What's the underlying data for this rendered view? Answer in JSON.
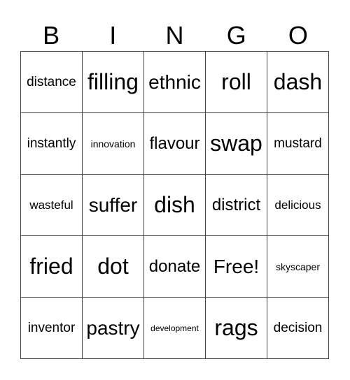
{
  "header": {
    "letters": [
      "B",
      "I",
      "N",
      "G",
      "O"
    ]
  },
  "cells": [
    [
      "distance",
      "filling",
      "ethnic",
      "roll",
      "dash"
    ],
    [
      "instantly",
      "innovation",
      "flavour",
      "swap",
      "mustard"
    ],
    [
      "wasteful",
      "suffer",
      "dish",
      "district",
      "delicious"
    ],
    [
      "fried",
      "dot",
      "donate",
      "Free!",
      "skyscaper"
    ],
    [
      "inventor",
      "pastry",
      "development",
      "rags",
      "decision"
    ]
  ]
}
